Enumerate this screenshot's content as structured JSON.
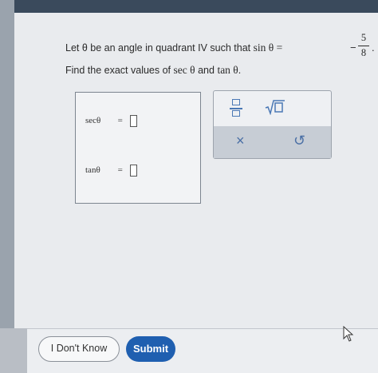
{
  "question": {
    "line1_prefix": "Let θ be an angle in quadrant IV such that",
    "sin_expr": "sin θ =",
    "sign": "−",
    "numerator": "5",
    "denominator": "8",
    "period": ".",
    "line2_prefix": "Find the exact values of",
    "sec_term": "sec θ",
    "and_word": "and",
    "tan_term": "tan θ",
    "line2_end": "."
  },
  "answers": [
    {
      "label": "secθ",
      "eq": "="
    },
    {
      "label": "tanθ",
      "eq": "="
    }
  ],
  "keypad": {
    "fraction_icon": "fraction-icon",
    "sqrt_icon": "square-root-icon",
    "clear_symbol": "×",
    "undo_symbol": "↺"
  },
  "buttons": {
    "dont_know": "I Don't Know",
    "submit": "Submit"
  },
  "colors": {
    "accent": "#1f5fb0",
    "keypad_icon": "#4a78b5"
  }
}
